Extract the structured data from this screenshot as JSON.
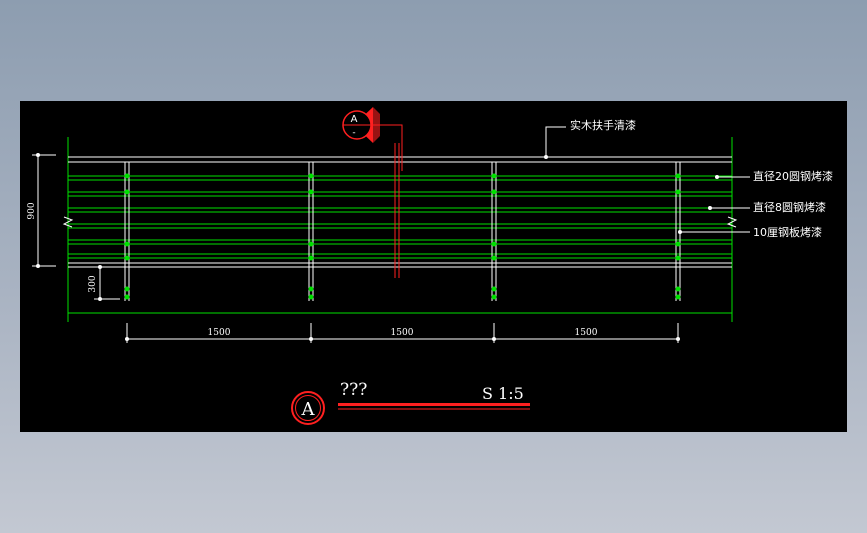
{
  "colors": {
    "background": "#000000",
    "rail": "#00e000",
    "line": "#ffffff",
    "accent": "#ff2020",
    "dimension": "#ffffff"
  },
  "callout": {
    "letter": "A",
    "sub": "-"
  },
  "labels": {
    "handrail": "实木扶手清漆",
    "round_bar_20": "直径20圆钢烤漆",
    "round_bar_8": "直径8圆钢烤漆",
    "steel_plate": "10厘钢板烤漆"
  },
  "dimensions": {
    "height_total": "900",
    "height_bottom": "300",
    "spans": [
      "1500",
      "1500",
      "1500"
    ]
  },
  "title_block": {
    "letter": "A",
    "title": "???",
    "scale": "S 1:5"
  }
}
